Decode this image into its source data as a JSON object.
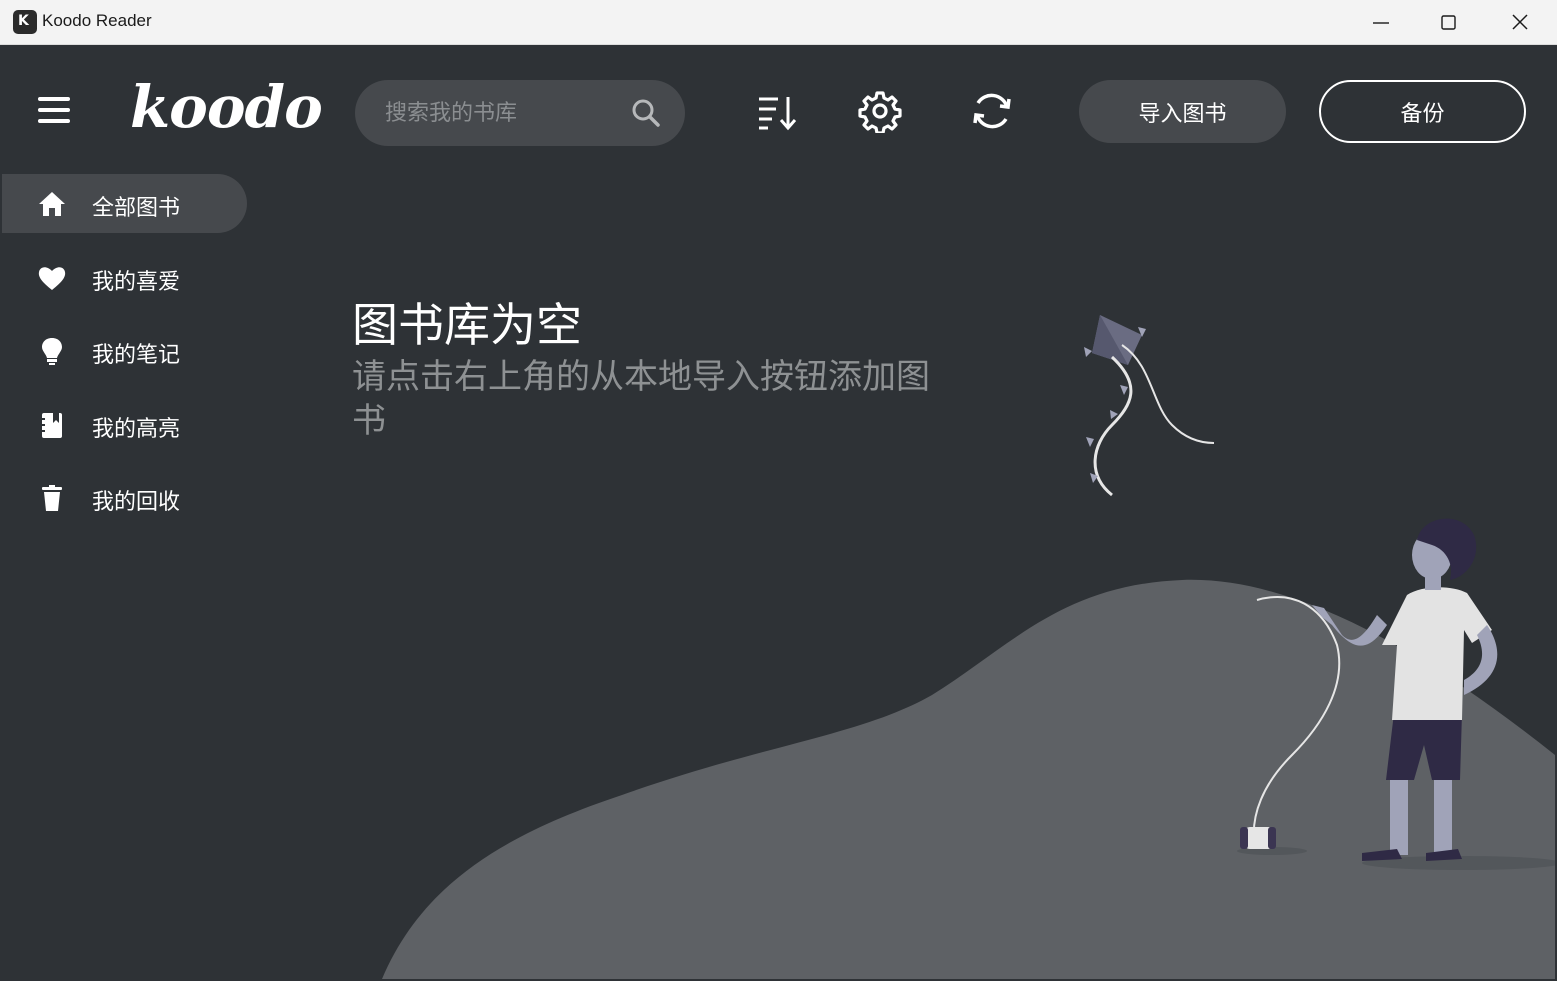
{
  "window": {
    "title": "Koodo Reader",
    "icon_letter": "K"
  },
  "header": {
    "logo": "koodo",
    "search_placeholder": "搜索我的书库",
    "import_label": "导入图书",
    "backup_label": "备份"
  },
  "sidebar": {
    "items": [
      {
        "label": "全部图书",
        "icon": "home-icon",
        "active": true
      },
      {
        "label": "我的喜爱",
        "icon": "heart-icon",
        "active": false
      },
      {
        "label": "我的笔记",
        "icon": "lightbulb-icon",
        "active": false
      },
      {
        "label": "我的高亮",
        "icon": "highlight-book-icon",
        "active": false
      },
      {
        "label": "我的回收",
        "icon": "trash-icon",
        "active": false
      }
    ]
  },
  "empty_state": {
    "title": "图书库为空",
    "description": "请点击右上角的从本地导入按钮添加图书"
  },
  "colors": {
    "background": "#2e3236",
    "panel": "#46494d",
    "hill": "#5e6165",
    "figure_accent": "#a0a3b8"
  }
}
